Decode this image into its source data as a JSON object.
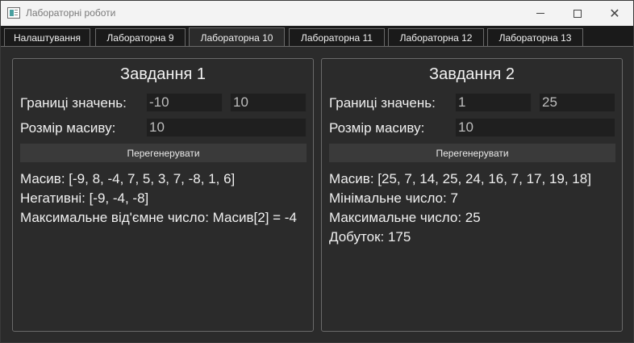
{
  "window": {
    "title": "Лабораторні роботи",
    "controls": {
      "minimize": "—",
      "maximize": "□",
      "close": "✕"
    }
  },
  "tabs": [
    {
      "label": "Налаштування",
      "active": false
    },
    {
      "label": "Лабораторна 9",
      "active": false
    },
    {
      "label": "Лабораторна 10",
      "active": true
    },
    {
      "label": "Лабораторна 11",
      "active": false
    },
    {
      "label": "Лабораторна 12",
      "active": false
    },
    {
      "label": "Лабораторна 13",
      "active": false
    }
  ],
  "task1": {
    "title": "Завдання 1",
    "bounds_label": "Границі значень:",
    "bound_min": "-10",
    "bound_max": "10",
    "size_label": "Розмір масиву:",
    "size_value": "10",
    "regenerate": "Перегенерувати",
    "output": [
      "Масив: [-9, 8, -4, 7, 5, 3, 7, -8, 1, 6]",
      "Негативні: [-9, -4, -8]",
      "Максимальне від'ємне число: Масив[2] = -4"
    ]
  },
  "task2": {
    "title": "Завдання 2",
    "bounds_label": "Границі значень:",
    "bound_min": "1",
    "bound_max": "25",
    "size_label": "Розмір масиву:",
    "size_value": "10",
    "regenerate": "Перегенерувати",
    "output": [
      "Масив: [25, 7, 14, 25, 24, 16, 7, 17, 19, 18]",
      "Мінімальне число: 7",
      "Максимальне число: 25",
      "Добуток: 175"
    ]
  }
}
